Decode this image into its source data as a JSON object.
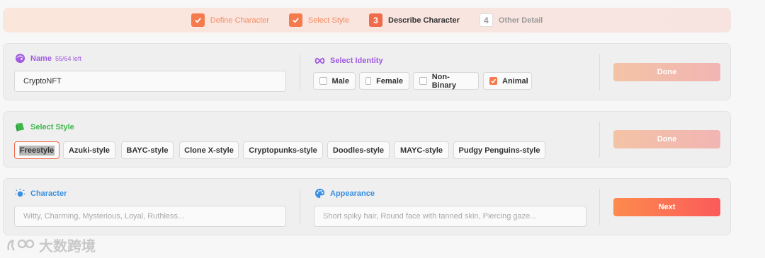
{
  "stepper": {
    "steps": [
      {
        "label": "Define Character",
        "marker": "",
        "state": "done"
      },
      {
        "label": "Select Style",
        "marker": "",
        "state": "done"
      },
      {
        "label": "Describe Character",
        "marker": "3",
        "state": "active"
      },
      {
        "label": "Other Detail",
        "marker": "4",
        "state": "todo"
      }
    ]
  },
  "name_section": {
    "title": "Name",
    "remaining": "55/64 left",
    "value": "CryptoNFT",
    "title_color": "#a05be0"
  },
  "identity_section": {
    "title": "Select Identity",
    "options": [
      {
        "label": "Male",
        "checked": false
      },
      {
        "label": "Female",
        "checked": false
      },
      {
        "label": "Non-Binary",
        "checked": false
      },
      {
        "label": "Animal",
        "checked": true
      }
    ],
    "title_color": "#a05be0"
  },
  "style_section": {
    "title": "Select Style",
    "title_color": "#3cb84a",
    "options": [
      "Freestyle",
      "Azuki-style",
      "BAYC-style",
      "Clone X-style",
      "Cryptopunks-style",
      "Doodles-style",
      "MAYC-style",
      "Pudgy Penguins-style"
    ],
    "selected": "Freestyle"
  },
  "character_section": {
    "title": "Character",
    "placeholder": "Witty, Charming, Mysterious, Loyal, Ruthless...",
    "title_color": "#3a8fe0"
  },
  "appearance_section": {
    "title": "Appearance",
    "placeholder": "Short spiky hair, Round face with tanned skin, Piercing gaze...",
    "title_color": "#3a8fe0"
  },
  "buttons": {
    "done_1": "Done",
    "done_2": "Done",
    "next": "Next"
  },
  "watermark": {
    "text": "大数跨境"
  },
  "icons": {
    "check": "check-icon",
    "name": "face-icon",
    "identity": "infinity-icon",
    "style": "tag-icon",
    "character": "lightbulb-icon",
    "appearance": "palette-icon"
  },
  "colors": {
    "accent": "#f57a4c",
    "next_start": "#fd8b4e",
    "next_end": "#fb5a5a"
  }
}
